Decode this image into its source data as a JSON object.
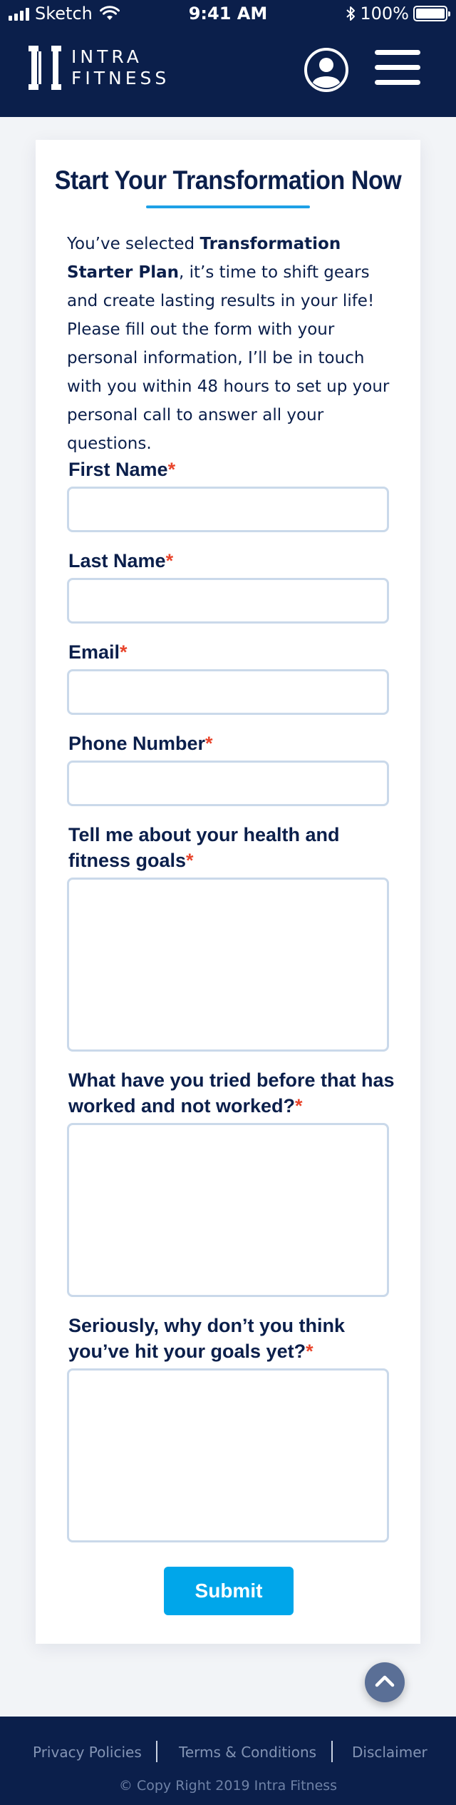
{
  "status_bar": {
    "carrier": "Sketch",
    "time": "9:41 AM",
    "battery": "100%",
    "icons": [
      "signal-icon",
      "wifi-icon",
      "bluetooth-icon",
      "battery-icon"
    ]
  },
  "header": {
    "logo_line1": "INTRA",
    "logo_line2": "FITNESS",
    "icons": [
      "logo-icon",
      "user-icon",
      "hamburger-menu-icon"
    ]
  },
  "form": {
    "title": "Start Your Transformation Now",
    "intro_prefix": "You’ve selected ",
    "intro_plan": "Transformation Starter Plan",
    "intro_suffix": ", it’s time to shift gears and create lasting results in your life! Please fill out the form with your personal information, I’ll be in touch with you within 48 hours to set up your personal call to answer all your questions.",
    "required_mark": "*",
    "fields": [
      {
        "label": "First Name",
        "value": ""
      },
      {
        "label": "Last Name",
        "value": ""
      },
      {
        "label": "Email",
        "value": ""
      },
      {
        "label": "Phone Number",
        "value": ""
      },
      {
        "label": "Tell me about your health and fitness goals",
        "value": ""
      },
      {
        "label": "What have you tried before that has worked and not worked?",
        "value": ""
      },
      {
        "label": "Seriously, why don’t you think you’ve hit your goals yet?",
        "value": ""
      }
    ],
    "submit_label": "Submit"
  },
  "footer": {
    "links": [
      "Privacy Policies",
      "Terms & Conditions",
      "Disclaimer"
    ],
    "copyright": "© Copy Right 2019 Intra Fitness"
  },
  "colors": {
    "brand_navy": "#0b1f4b",
    "accent_blue": "#00a6ea",
    "required_red": "#e8452c",
    "input_border": "#cad9ea"
  }
}
